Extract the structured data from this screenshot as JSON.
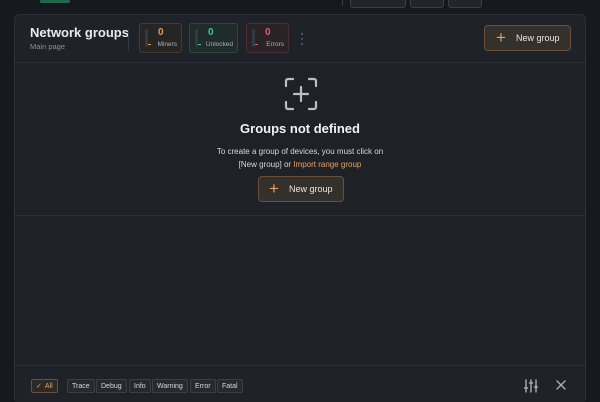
{
  "header": {
    "title": "Network groups",
    "subtitle": "Main page",
    "new_group_label": "New group"
  },
  "stats": {
    "miners": {
      "value": "0",
      "label": "Miners",
      "color": "#e69a5b"
    },
    "unlocked": {
      "value": "0",
      "label": "Unlocked",
      "color": "#3ec39a"
    },
    "errors": {
      "value": "0",
      "label": "Errors",
      "color": "#e05a6b"
    }
  },
  "empty_state": {
    "icon": "add-group-icon",
    "title": "Groups not defined",
    "desc_line1": "To create a group of devices, you must click on",
    "desc_line2_prefix": "[New group] or ",
    "import_link": "Import range group",
    "button_label": "New group"
  },
  "log_filters": {
    "all": "All",
    "trace": "Trace",
    "debug": "Debug",
    "info": "Info",
    "warning": "Warning",
    "error": "Error",
    "fatal": "Fatal"
  },
  "colors": {
    "accent": "#e7a063",
    "background": "#16191d",
    "panel": "#1f2329"
  }
}
